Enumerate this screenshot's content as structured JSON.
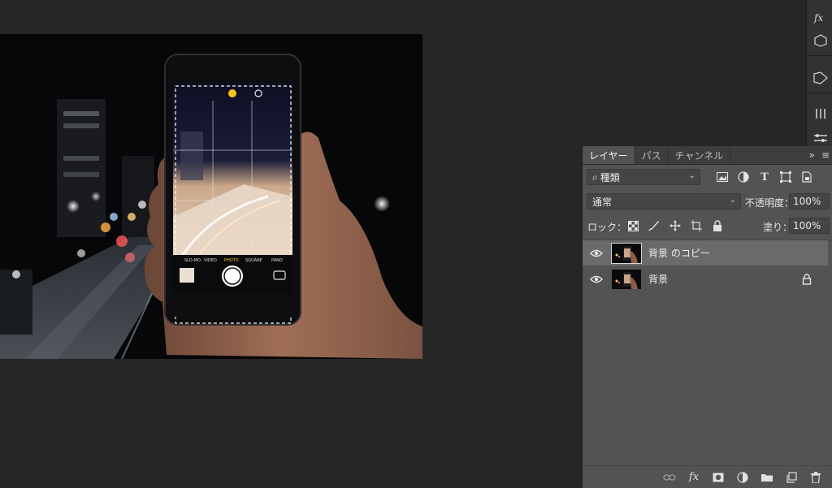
{
  "layers_panel": {
    "tabs": [
      {
        "label": "レイヤー",
        "active": true
      },
      {
        "label": "パス",
        "active": false
      },
      {
        "label": "チャンネル",
        "active": false
      }
    ],
    "collapse_label": "»",
    "menu_label": "≡",
    "filter_kind": "種類",
    "blend_mode": "通常",
    "opacity_label": "不透明度：",
    "opacity_value": "100%",
    "lock_label": "ロック：",
    "fill_label": "塗り：",
    "fill_value": "100%",
    "layers": [
      {
        "name": "背景 のコピー",
        "selected": true,
        "visible": true,
        "locked": false
      },
      {
        "name": "背景",
        "selected": false,
        "visible": true,
        "locked": true
      }
    ]
  },
  "toolbar_icons": [
    "libraries-icon",
    "adjustments-icon",
    "brush-settings-icon",
    "properties-icon"
  ],
  "canvas": {
    "image_description_icons": [
      "night-highway-photo",
      "smartphone-in-hand"
    ],
    "phone_modes": [
      "SLO-MO",
      "VIDEO",
      "PHOTO",
      "SQUARE",
      "PANO"
    ]
  },
  "colors": {
    "app_bg": "#262626",
    "panel_bg": "#535353",
    "selected_row": "#6a6a6a",
    "accent_mode": "#f5c518"
  }
}
